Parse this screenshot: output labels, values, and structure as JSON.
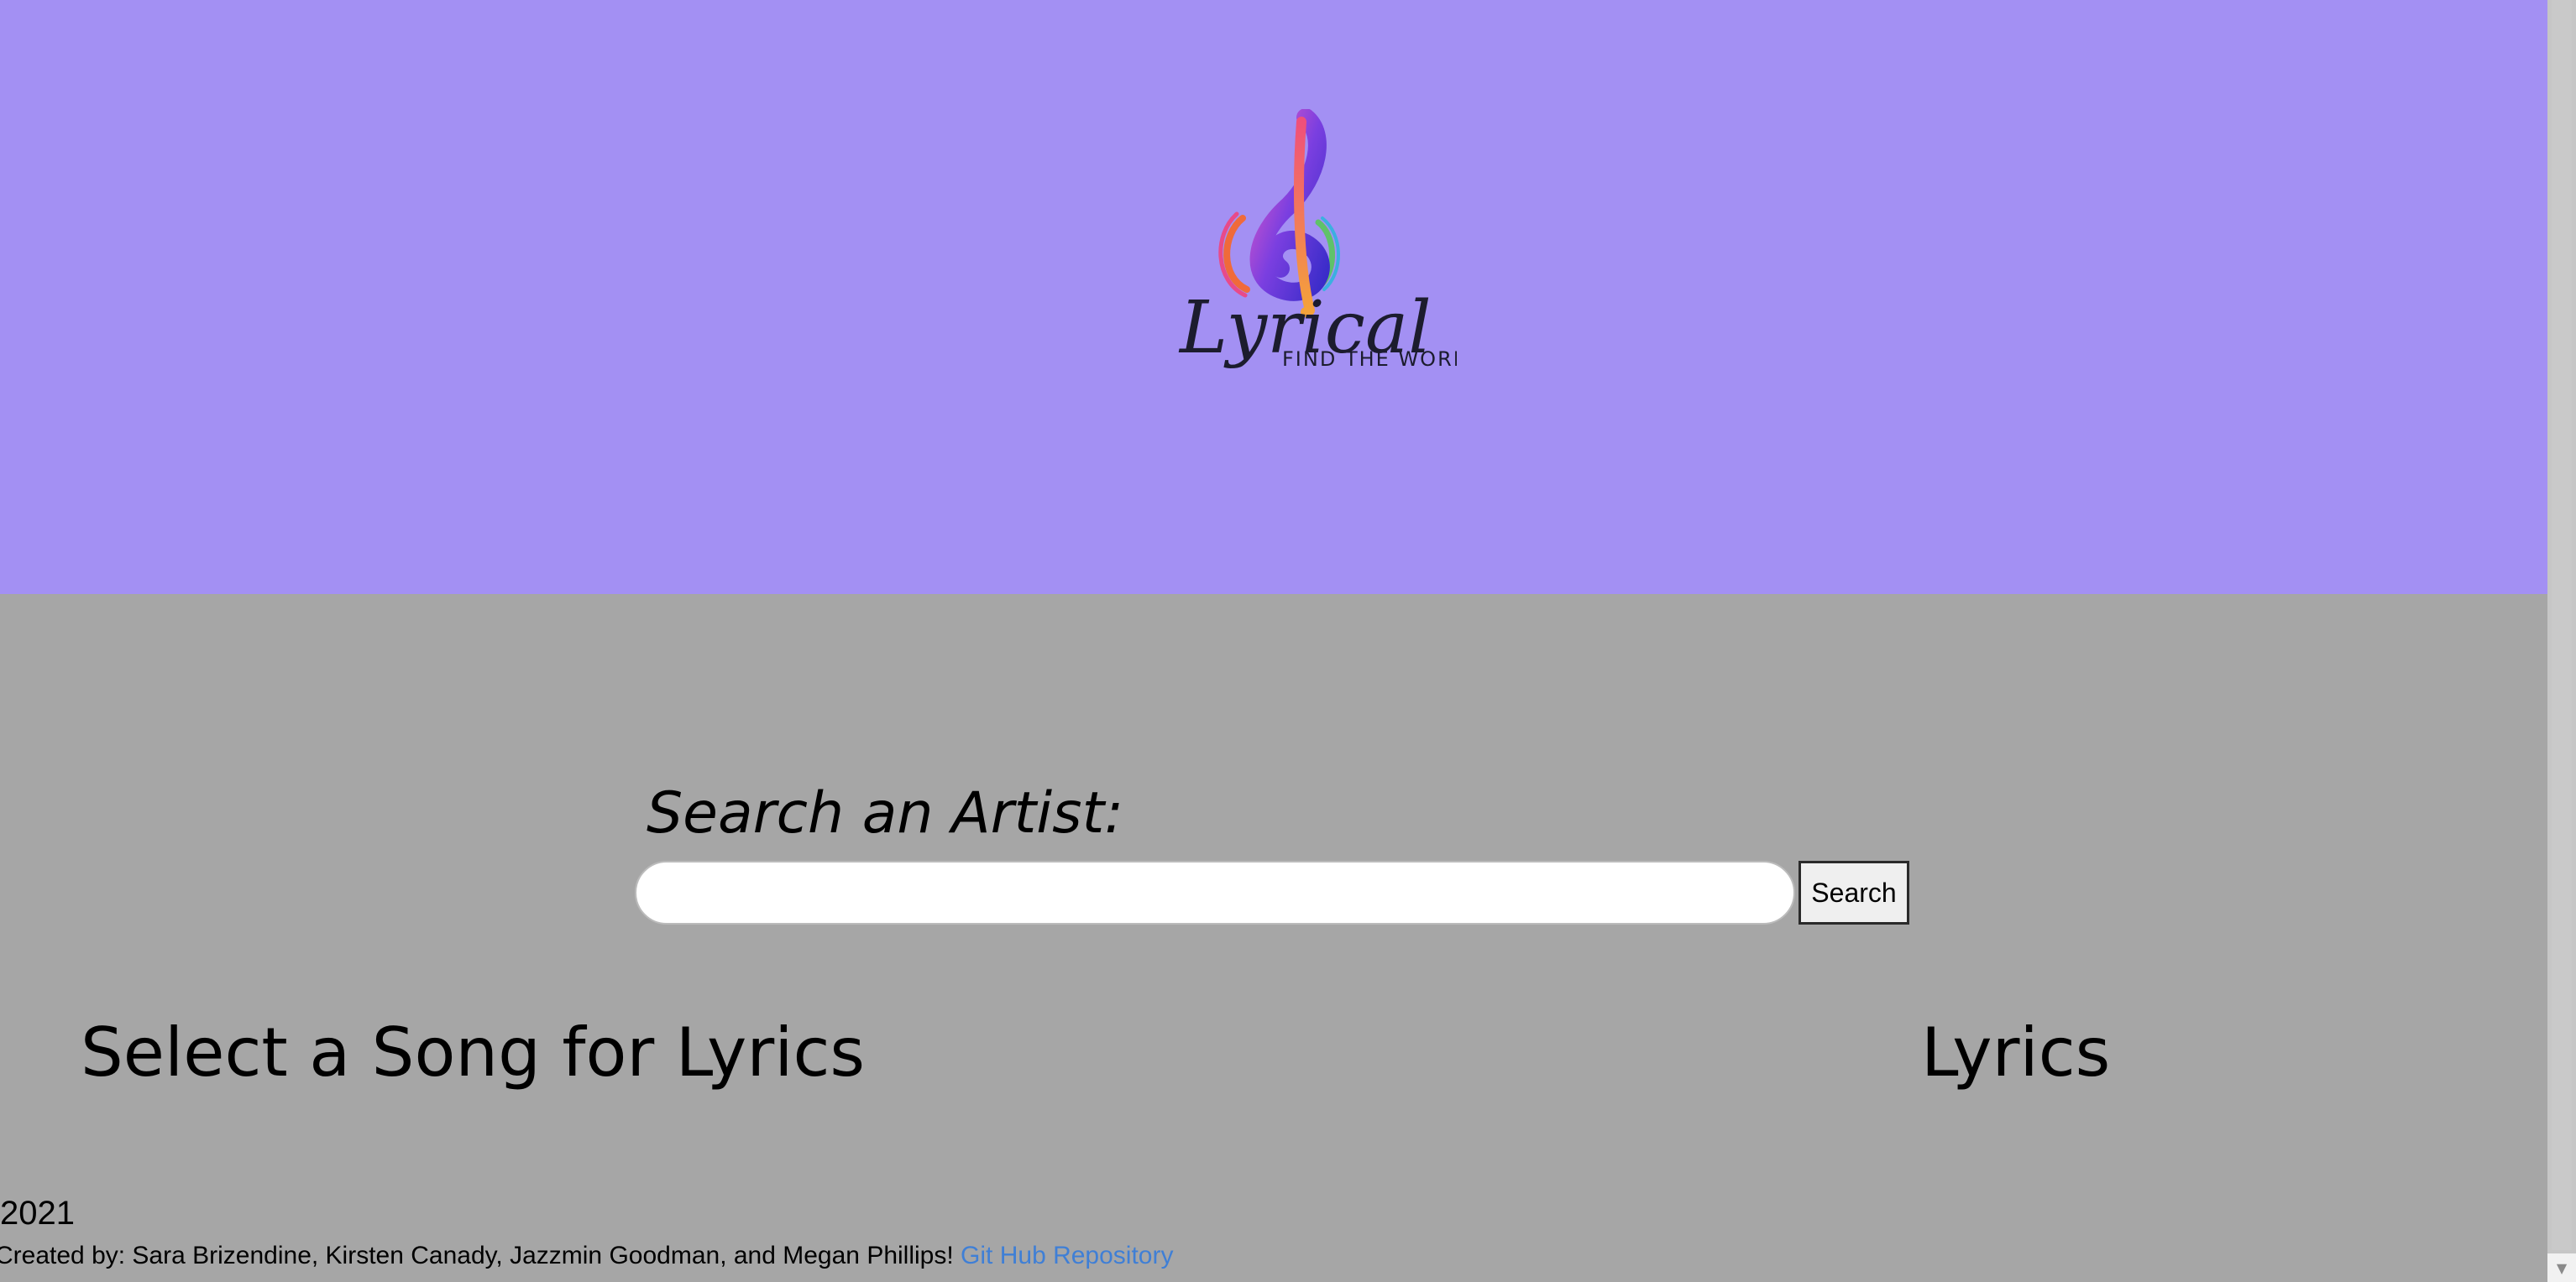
{
  "header": {
    "background_color": "#a390f3",
    "logo": {
      "wordmark": "Lyrical",
      "tagline": "FIND THE WORDS",
      "icon": "treble-clef-icon"
    }
  },
  "search": {
    "label": "Search an Artist:",
    "input_value": "",
    "button_label": "Search"
  },
  "main": {
    "songs_heading": "Select a Song for Lyrics",
    "lyrics_heading": "Lyrics",
    "background_color": "#a6a6a6"
  },
  "footer": {
    "year": "2021",
    "credits": "Created by: Sara Brizendine, Kirsten Canady, Jazzmin Goodman, and Megan Phillips! ",
    "repo_link_label": "Git Hub Repository",
    "link_color": "#3f7fd6"
  },
  "scrollbar": {
    "down_arrow_icon": "scroll-down-arrow-icon"
  }
}
